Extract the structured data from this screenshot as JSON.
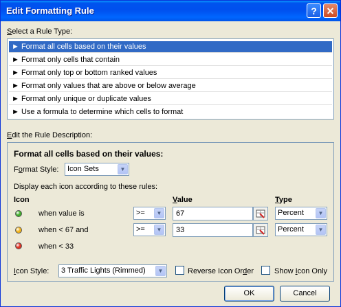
{
  "window": {
    "title": "Edit Formatting Rule",
    "help_icon": "?",
    "close_icon": "✕"
  },
  "rule_type": {
    "label_pre": "",
    "label_u": "S",
    "label_post": "elect a Rule Type:",
    "items": [
      {
        "label": "► Format all cells based on their values",
        "selected": true
      },
      {
        "label": "► Format only cells that contain",
        "selected": false
      },
      {
        "label": "► Format only top or bottom ranked values",
        "selected": false
      },
      {
        "label": "► Format only values that are above or below average",
        "selected": false
      },
      {
        "label": "► Format only unique or duplicate values",
        "selected": false
      },
      {
        "label": "► Use a formula to determine which cells to format",
        "selected": false
      }
    ]
  },
  "description": {
    "label_u": "E",
    "label_post": "dit the Rule Description:",
    "heading": "Format all cells based on their values:",
    "format_style_label_pre": "F",
    "format_style_label_u": "o",
    "format_style_label_post": "rmat Style:",
    "format_style_value": "Icon Sets",
    "display_text": "Display each icon according to these rules:",
    "col_icon": "Icon",
    "col_value_u": "V",
    "col_value_post": "alue",
    "col_type_u": "T",
    "col_type_post": "ype",
    "rules": [
      {
        "condition": "when value is",
        "operator": ">=",
        "value": "67",
        "type": "Percent",
        "color": "#3fae2a"
      },
      {
        "condition": "when < 67 and",
        "operator": ">=",
        "value": "33",
        "type": "Percent",
        "color": "#f2b31b"
      },
      {
        "condition": "when < 33",
        "color": "#e03324"
      }
    ],
    "icon_style_label_pre": "",
    "icon_style_label_u": "I",
    "icon_style_label_post": "con Style:",
    "icon_style_value": "3 Traffic Lights (Rimmed)",
    "reverse_label_pre": "Reverse Icon Or",
    "reverse_label_u": "d",
    "reverse_label_post": "er",
    "show_label_pre": "Show ",
    "show_label_u": "I",
    "show_label_post": "con Only"
  },
  "buttons": {
    "ok": "OK",
    "cancel": "Cancel"
  }
}
